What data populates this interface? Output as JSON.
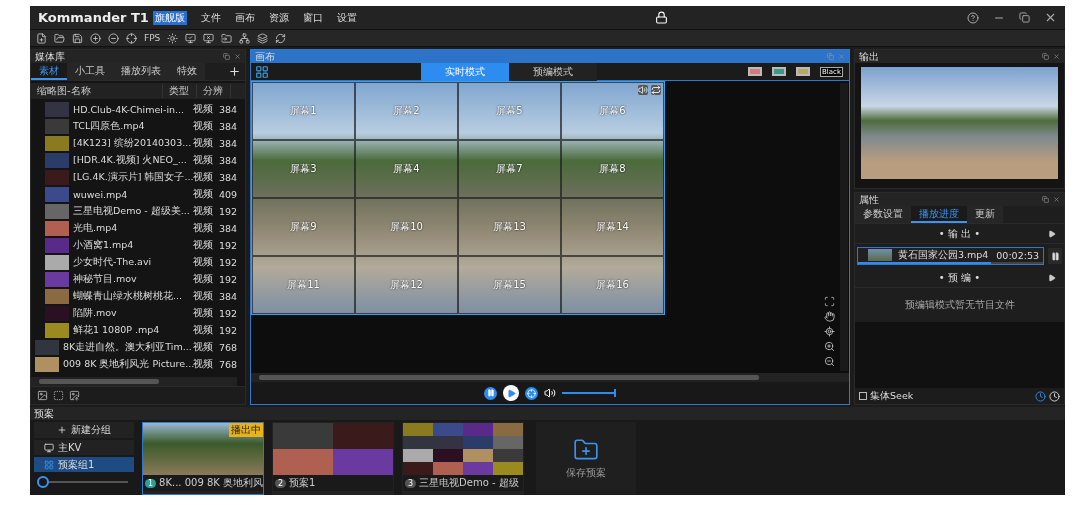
{
  "app": {
    "logo": "Kommander T1",
    "edition": "旗舰版",
    "menu": [
      "文件",
      "画布",
      "资源",
      "窗口",
      "设置"
    ]
  },
  "toolbar": {
    "fps": "FPS"
  },
  "media_library": {
    "title": "媒体库",
    "tabs": [
      {
        "label": "素材",
        "selected": true
      },
      {
        "label": "小工具",
        "selected": false
      },
      {
        "label": "播放列表",
        "selected": false
      },
      {
        "label": "特效",
        "selected": false
      }
    ],
    "columns": [
      "缩略图-名称",
      "类型",
      "分辨"
    ],
    "rows": [
      {
        "name": "HD.Club-4K-Chimei-in...",
        "type": "视频",
        "resolution": "384"
      },
      {
        "name": "TCL四原色.mp4",
        "type": "视频",
        "resolution": "384"
      },
      {
        "name": "[4K123] 缤纷20140303...",
        "type": "视频",
        "resolution": "384"
      },
      {
        "name": "[HDR.4K.视频] 火NEO_...",
        "type": "视频",
        "resolution": "384"
      },
      {
        "name": "[LG.4K.演示片] 韩国女子...",
        "type": "视频",
        "resolution": "384"
      },
      {
        "name": "wuwei.mp4",
        "type": "视频",
        "resolution": "409"
      },
      {
        "name": "三星电视Demo - 超级美...",
        "type": "视频",
        "resolution": "192"
      },
      {
        "name": "光电.mp4",
        "type": "视频",
        "resolution": "384"
      },
      {
        "name": "小酒窝1.mp4",
        "type": "视频",
        "resolution": "192"
      },
      {
        "name": "少女时代-The.avi",
        "type": "视频",
        "resolution": "192"
      },
      {
        "name": "神秘节目.mov",
        "type": "视频",
        "resolution": "192"
      },
      {
        "name": "蝴蝶青山绿水桃树桃花...",
        "type": "视频",
        "resolution": "384"
      },
      {
        "name": "陷阱.mov",
        "type": "视频",
        "resolution": "192"
      },
      {
        "name": "鲜花1 1080P .mp4",
        "type": "视频",
        "resolution": "192"
      },
      {
        "name": "8K走进自然。澳大利亚Tim...",
        "type": "视频",
        "resolution": "768"
      },
      {
        "name": "009 8K 奥地利风光 Picture...",
        "type": "视频",
        "resolution": "768"
      }
    ]
  },
  "canvas": {
    "title": "画布",
    "modes": [
      {
        "label": "实时模式",
        "selected": true
      },
      {
        "label": "预编模式",
        "selected": false
      }
    ],
    "background_button": "Black",
    "screens": [
      "屏幕1",
      "屏幕2",
      "屏幕5",
      "屏幕6",
      "屏幕3",
      "屏幕4",
      "屏幕7",
      "屏幕8",
      "屏幕9",
      "屏幕10",
      "屏幕13",
      "屏幕14",
      "屏幕11",
      "屏幕12",
      "屏幕15",
      "屏幕16"
    ],
    "volume": {
      "level": 1
    }
  },
  "output": {
    "title": "输出"
  },
  "properties": {
    "title": "属性",
    "tabs": [
      {
        "label": "参数设置",
        "selected": false
      },
      {
        "label": "播放进度",
        "selected": true
      },
      {
        "label": "更新",
        "selected": false
      }
    ],
    "output_section": "• 输 出 •",
    "now_playing": {
      "name": "黄石国家公园3.mp4",
      "time": "00:02:53",
      "level": 0.72
    },
    "preview_section": "• 预 编 •",
    "preview_empty": "预编辑模式暂无节目文件",
    "group_seek": {
      "label": "集体Seek",
      "checked": false
    }
  },
  "presets": {
    "title": "预案",
    "new_group": "新建分组",
    "groups": [
      {
        "label": "主KV",
        "selected": false,
        "kind": "single"
      },
      {
        "label": "预案组1",
        "selected": true,
        "kind": "grid"
      }
    ],
    "cards": [
      {
        "number": "1",
        "name": "8K... 009 8K 奥地利风",
        "badge": "播出中",
        "selected": true,
        "kind": "single"
      },
      {
        "number": "2",
        "name": "预案1",
        "selected": false,
        "kind": "quad"
      },
      {
        "number": "3",
        "name": "三星电视Demo - 超级",
        "selected": false,
        "kind": "mosaic"
      }
    ],
    "save": "保存预案",
    "zoom": {
      "level": 0.03
    }
  }
}
